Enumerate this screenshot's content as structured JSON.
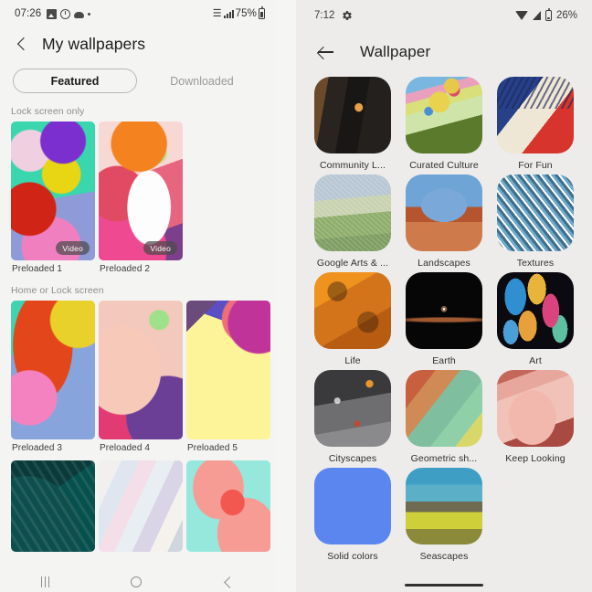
{
  "left_phone": {
    "status_bar": {
      "time": "07:26",
      "icons": [
        "photo-icon",
        "clock-icon",
        "cloud-icon",
        "dot-icon"
      ],
      "wifi_icon": "wifi-icon",
      "signal_icon": "cellular-signal-icon",
      "battery_percent": "75%",
      "battery_icon": "battery-icon"
    },
    "app_bar": {
      "back_icon": "back-chevron-icon",
      "title": "My wallpapers"
    },
    "tabs": [
      {
        "label": "Featured",
        "selected": true
      },
      {
        "label": "Downloaded",
        "selected": false
      }
    ],
    "sections": [
      {
        "label": "Lock screen only",
        "items": [
          {
            "caption": "Preloaded 1",
            "badge": "Video",
            "art": "a1"
          },
          {
            "caption": "Preloaded 2",
            "badge": "Video",
            "art": "a2"
          }
        ]
      },
      {
        "label": "Home or Lock screen",
        "items": [
          {
            "caption": "Preloaded 3",
            "badge": "",
            "art": "a3"
          },
          {
            "caption": "Preloaded 4",
            "badge": "",
            "art": "a4"
          },
          {
            "caption": "Preloaded 5",
            "badge": "",
            "art": "a5"
          }
        ]
      },
      {
        "label": "",
        "items": [
          {
            "caption": "",
            "badge": "",
            "art": "a6"
          },
          {
            "caption": "",
            "badge": "",
            "art": "a7"
          },
          {
            "caption": "",
            "badge": "",
            "art": "a8"
          }
        ]
      }
    ],
    "nav_bar": {
      "recents_icon": "recents-icon",
      "home_icon": "home-icon",
      "back_icon": "back-icon"
    }
  },
  "right_phone": {
    "status_bar": {
      "time": "7:12",
      "gear_icon": "gear-icon",
      "wifi_icon": "wifi-icon",
      "signal_icon": "cellular-signal-icon",
      "battery_percent": "26%",
      "battery_icon": "battery-icon"
    },
    "app_bar": {
      "back_icon": "arrow-back-icon",
      "title": "Wallpaper"
    },
    "categories": [
      {
        "label": "Community L...",
        "art": "c-community"
      },
      {
        "label": "Curated Culture",
        "art": "c-curated"
      },
      {
        "label": "For Fun",
        "art": "c-forfun"
      },
      {
        "label": "Google Arts & ...",
        "art": "c-googlearts"
      },
      {
        "label": "Landscapes",
        "art": "c-landscapes"
      },
      {
        "label": "Textures",
        "art": "c-textures"
      },
      {
        "label": "Life",
        "art": "c-life"
      },
      {
        "label": "Earth",
        "art": "c-earth"
      },
      {
        "label": "Art",
        "art": "c-art"
      },
      {
        "label": "Cityscapes",
        "art": "c-city"
      },
      {
        "label": "Geometric sh...",
        "art": "c-geom"
      },
      {
        "label": "Keep Looking",
        "art": "c-keep"
      },
      {
        "label": "Solid colors",
        "art": "c-solid"
      },
      {
        "label": "Seascapes",
        "art": "c-sea"
      }
    ],
    "gesture_bar": "gesture-handle"
  },
  "colors": {
    "left_background": "#f4f4f2",
    "right_background": "#edeceb",
    "left_text_primary": "#1b1b1b",
    "left_text_muted": "#8d8d8d",
    "right_text_primary": "#1f1f1f",
    "solid_color_swatch": "#5b86ef"
  }
}
